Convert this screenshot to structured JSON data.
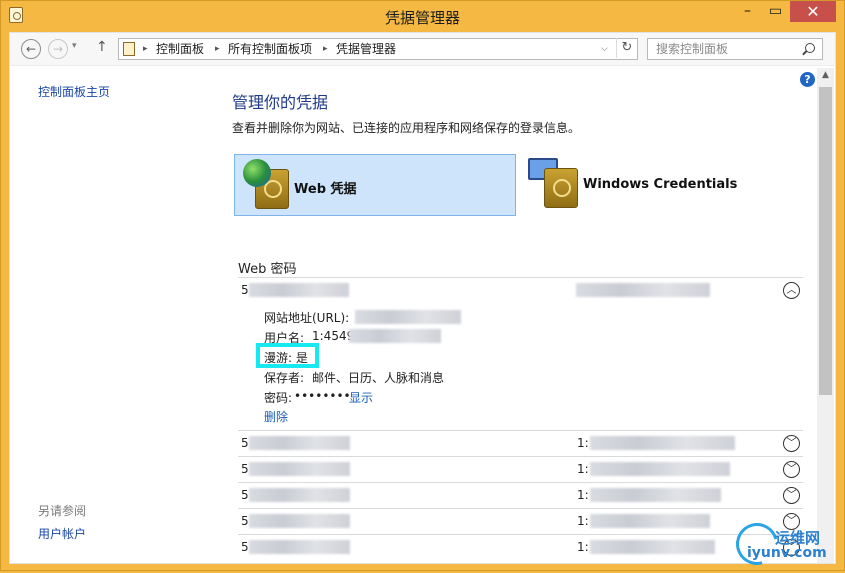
{
  "window": {
    "title": "凭据管理器",
    "controls": {
      "minimize": "–",
      "maximize": "▭",
      "close": "✕"
    }
  },
  "nav": {
    "back": "←",
    "forward": "→",
    "dropdown": "▾",
    "up": "↑",
    "breadcrumbs": [
      "控制面板",
      "所有控制面板项",
      "凭据管理器"
    ],
    "breadcrumb_separator": "▸",
    "address_dropdown": "⌵",
    "refresh": "↻",
    "search_placeholder": "搜索控制面板"
  },
  "sidebar": {
    "home": "控制面板主页",
    "see_also": "另请参阅",
    "user_accounts": "用户帐户"
  },
  "main": {
    "help": "?",
    "heading": "管理你的凭据",
    "subtitle": "查看并删除你为网站、已连接的应用程序和网络保存的登录信息。",
    "tiles": [
      {
        "label": "Web 凭据",
        "selected": true,
        "icon": "globe-vault-icon"
      },
      {
        "label": "Windows Credentials",
        "selected": false,
        "icon": "monitor-vault-icon"
      }
    ],
    "section_title": "Web 密码",
    "expanded": {
      "prefix": "5",
      "url_label": "网站地址(URL):",
      "user_label": "用户名:",
      "user_prefix": "1:4549",
      "roaming": "漫游: 是",
      "saved_by_label": "保存者:",
      "saved_by": "邮件、日历、人脉和消息",
      "password_label": "密码:",
      "password_mask": "••••••••",
      "show": "显示",
      "delete": "删除"
    },
    "rows": [
      {
        "prefix": "5",
        "second_prefix": "1:"
      },
      {
        "prefix": "5",
        "second_prefix": "1:"
      },
      {
        "prefix": "5",
        "second_prefix": "1:"
      },
      {
        "prefix": "5",
        "second_prefix": "1:"
      },
      {
        "prefix": "5",
        "second_prefix": "1:"
      }
    ],
    "chevron_up": "︿",
    "chevron_down": "﹀"
  },
  "watermark": {
    "cn": "运维网",
    "en": "iyunv.com"
  },
  "colors": {
    "frame": "#f5b842",
    "highlight": "#18e8f0",
    "link": "#1b47a6",
    "tile_selected": "#cde4fa"
  }
}
